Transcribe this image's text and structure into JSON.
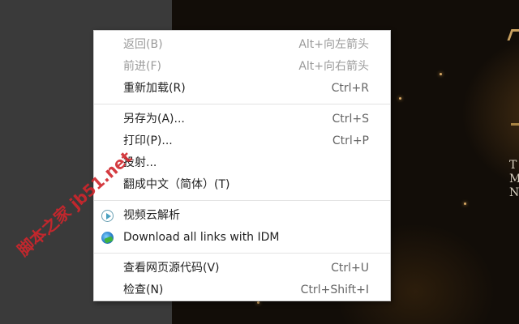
{
  "menu": {
    "items": [
      {
        "label": "返回(B)",
        "shortcut": "Alt+向左箭头",
        "disabled": true
      },
      {
        "label": "前进(F)",
        "shortcut": "Alt+向右箭头",
        "disabled": true
      },
      {
        "label": "重新加载(R)",
        "shortcut": "Ctrl+R",
        "disabled": false
      },
      {
        "label": "另存为(A)...",
        "shortcut": "Ctrl+S",
        "disabled": false
      },
      {
        "label": "打印(P)...",
        "shortcut": "Ctrl+P",
        "disabled": false
      },
      {
        "label": "投射...",
        "shortcut": "",
        "disabled": false
      },
      {
        "label": "翻成中文（简体）(T)",
        "shortcut": "",
        "disabled": false
      },
      {
        "label": "视频云解析",
        "shortcut": "",
        "icon": "video-play-icon"
      },
      {
        "label": "Download all links with IDM",
        "shortcut": "",
        "icon": "idm-download-icon"
      },
      {
        "label": "查看网页源代码(V)",
        "shortcut": "Ctrl+U",
        "disabled": false
      },
      {
        "label": "检查(N)",
        "shortcut": "Ctrl+Shift+I",
        "disabled": false
      }
    ]
  },
  "background": {
    "letters": [
      "T",
      "M",
      "N"
    ]
  },
  "watermark": {
    "text": "脚本之家 jb51.net",
    "color": "#d0262c"
  }
}
